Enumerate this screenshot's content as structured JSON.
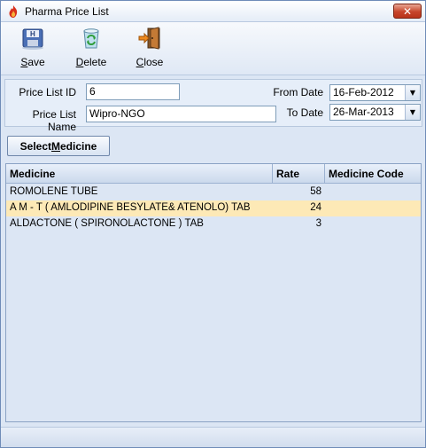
{
  "window": {
    "title": "Pharma Price List",
    "close_glyph": "✕",
    "app_icon": "flame-app-icon"
  },
  "toolbar": {
    "save": {
      "pre": "",
      "u": "S",
      "post": "ave",
      "icon": "floppy-disk-icon"
    },
    "delete": {
      "pre": "",
      "u": "D",
      "post": "elete",
      "icon": "recycle-bin-icon"
    },
    "close": {
      "pre": "",
      "u": "C",
      "post": "lose",
      "icon": "exit-door-icon"
    }
  },
  "form": {
    "price_list_id_label": "Price List ID",
    "price_list_id_value": "6",
    "price_list_name_label": "Price List Name",
    "price_list_name_value": "Wipro-NGO",
    "from_date_label": "From Date",
    "from_date_value": "16-Feb-2012",
    "to_date_label": "To Date",
    "to_date_value": "26-Mar-2013",
    "dropdown_glyph": "▼"
  },
  "select_medicine": {
    "pre": "Select ",
    "u": "M",
    "post": "edicine"
  },
  "grid": {
    "columns": {
      "medicine": "Medicine",
      "rate": "Rate",
      "code": "Medicine Code"
    },
    "rows": [
      {
        "medicine": "ROMOLENE TUBE",
        "rate": "58",
        "code": ""
      },
      {
        "medicine": "A M - T ( AMLODIPINE BESYLATE& ATENOLO) TAB",
        "rate": "24",
        "code": ""
      },
      {
        "medicine": "ALDACTONE ( SPIRONOLACTONE ) TAB",
        "rate": "3",
        "code": ""
      }
    ],
    "selected_row_color": "#fde9b6"
  }
}
